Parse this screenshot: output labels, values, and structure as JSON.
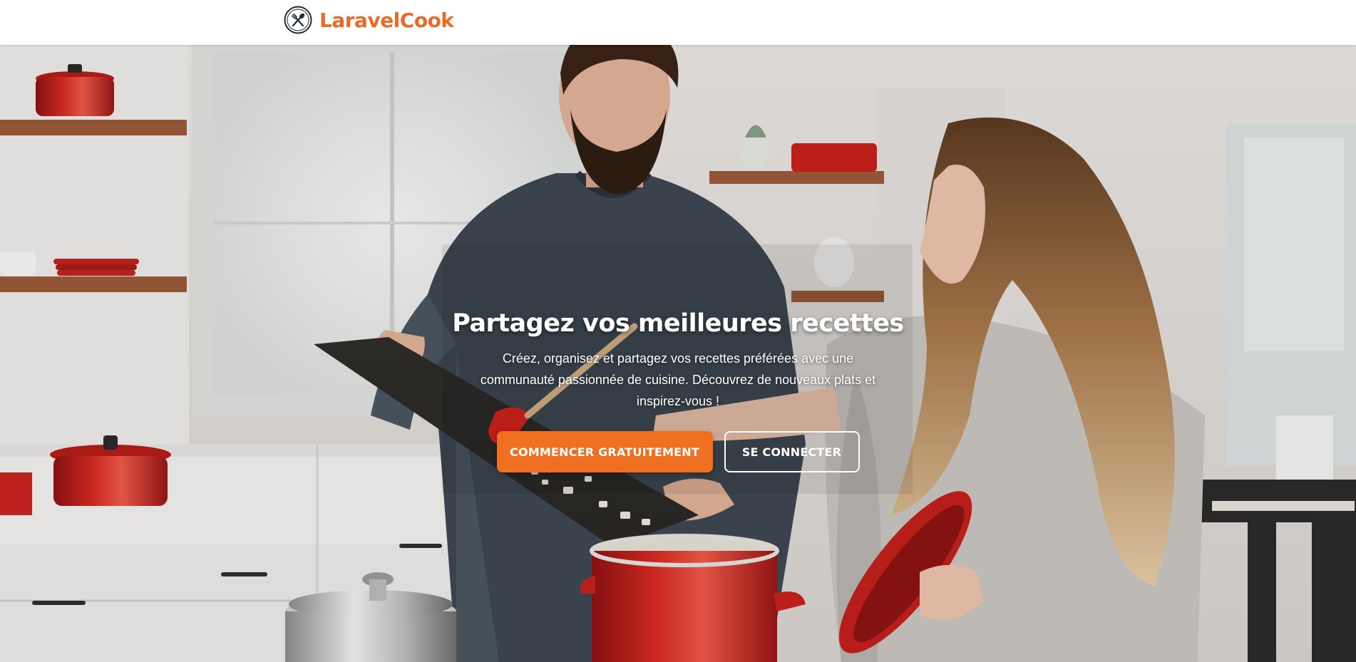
{
  "navbar": {
    "brand_name": "LaravelCook",
    "brand_icon": "utensils-icon"
  },
  "hero": {
    "title": "Partagez vos meilleures recettes",
    "subtitle": "Créez, organisez et partagez vos recettes préférées avec une communauté passionnée de cuisine. Découvrez de nouveaux plats et inspirez-vous !",
    "primary_cta_label": "COMMENCER GRATUITEMENT",
    "secondary_cta_label": "SE CONNECTER",
    "background": "kitchen-couple-cooking-photo"
  },
  "colors": {
    "accent": "#f07022",
    "brand_text": "#ea6b26"
  }
}
